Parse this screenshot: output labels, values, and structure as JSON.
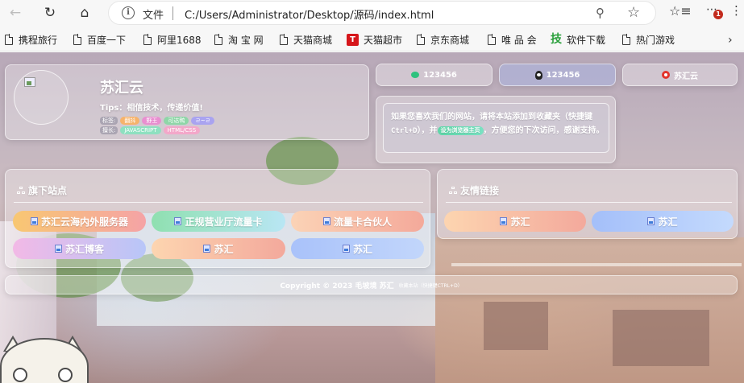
{
  "browser": {
    "address_label": "文件",
    "url": "C:/Users/Administrator/Desktop/源码/index.html",
    "extension_badge": "1",
    "bookmarks": [
      {
        "label": "携程旅行"
      },
      {
        "label": "百度一下"
      },
      {
        "label": "阿里1688"
      },
      {
        "label": "淘 宝 网"
      },
      {
        "label": "天猫商城"
      },
      {
        "label": "天猫超市",
        "icon_text": "T"
      },
      {
        "label": "京东商城"
      },
      {
        "label": "唯 品 会"
      },
      {
        "label": "软件下载",
        "icon_text": "技"
      },
      {
        "label": "热门游戏"
      }
    ]
  },
  "profile": {
    "site_name": "苏汇云",
    "tips": "Tips：相信技术，传递价值!",
    "tags_label": "标签:",
    "tags": [
      {
        "label": "翻抖",
        "color": "#f6b36b"
      },
      {
        "label": "野王",
        "color": "#e88fd0"
      },
      {
        "label": "可达鸭",
        "color": "#8fd6a8"
      },
      {
        "label": "ㄹ~ㄹ",
        "color": "#a9a3f0"
      }
    ],
    "skills_label": "擅长:",
    "skills": [
      {
        "label": "JAVASCRIPT",
        "color": "#8ee0c0"
      },
      {
        "label": "HTML/CSS",
        "color": "#f3a7c9"
      }
    ]
  },
  "contacts": [
    {
      "label": "123456",
      "icon": "wechat-icon"
    },
    {
      "label": "123456",
      "icon": "qq-icon"
    },
    {
      "label": "苏汇云",
      "icon": "weibo-icon"
    }
  ],
  "notice": {
    "text_before": "如果您喜欢我们的网站，请将本站添加到收藏夹（快捷键",
    "shortcut": "Ctrl+D",
    "text_mid": "），并",
    "button": "设为浏览器主页",
    "text_after": "，方便您的下次访问，感谢支持。"
  },
  "sites": {
    "title": "旗下站点",
    "items": [
      {
        "label": "苏汇云海内外服务器",
        "gradient": [
          "#f8c772",
          "#f5a3a6"
        ]
      },
      {
        "label": "正规营业厅流量卡",
        "gradient": [
          "#8fe0b0",
          "#b9e6f4"
        ]
      },
      {
        "label": "流量卡合伙人",
        "gradient": [
          "#fbd3b6",
          "#f4a99a"
        ]
      },
      {
        "label": "苏汇博客",
        "gradient": [
          "#f2b9e6",
          "#b8c6f8"
        ]
      },
      {
        "label": "苏汇",
        "gradient": [
          "#fdd5b0",
          "#f3a99c"
        ]
      },
      {
        "label": "苏汇",
        "gradient": [
          "#a9c2fa",
          "#c2d6fb"
        ]
      }
    ]
  },
  "links": {
    "title": "友情链接",
    "items": [
      {
        "label": "苏汇",
        "gradient": [
          "#fdd5b0",
          "#f3a99c"
        ]
      },
      {
        "label": "苏汇",
        "gradient": [
          "#a4bff9",
          "#c4dafd"
        ]
      }
    ]
  },
  "footer": {
    "copyright": "Copyright © 2023 毛坡境 苏汇",
    "bookmark_hint": "收藏本站（快捷键CTRL+D）"
  }
}
